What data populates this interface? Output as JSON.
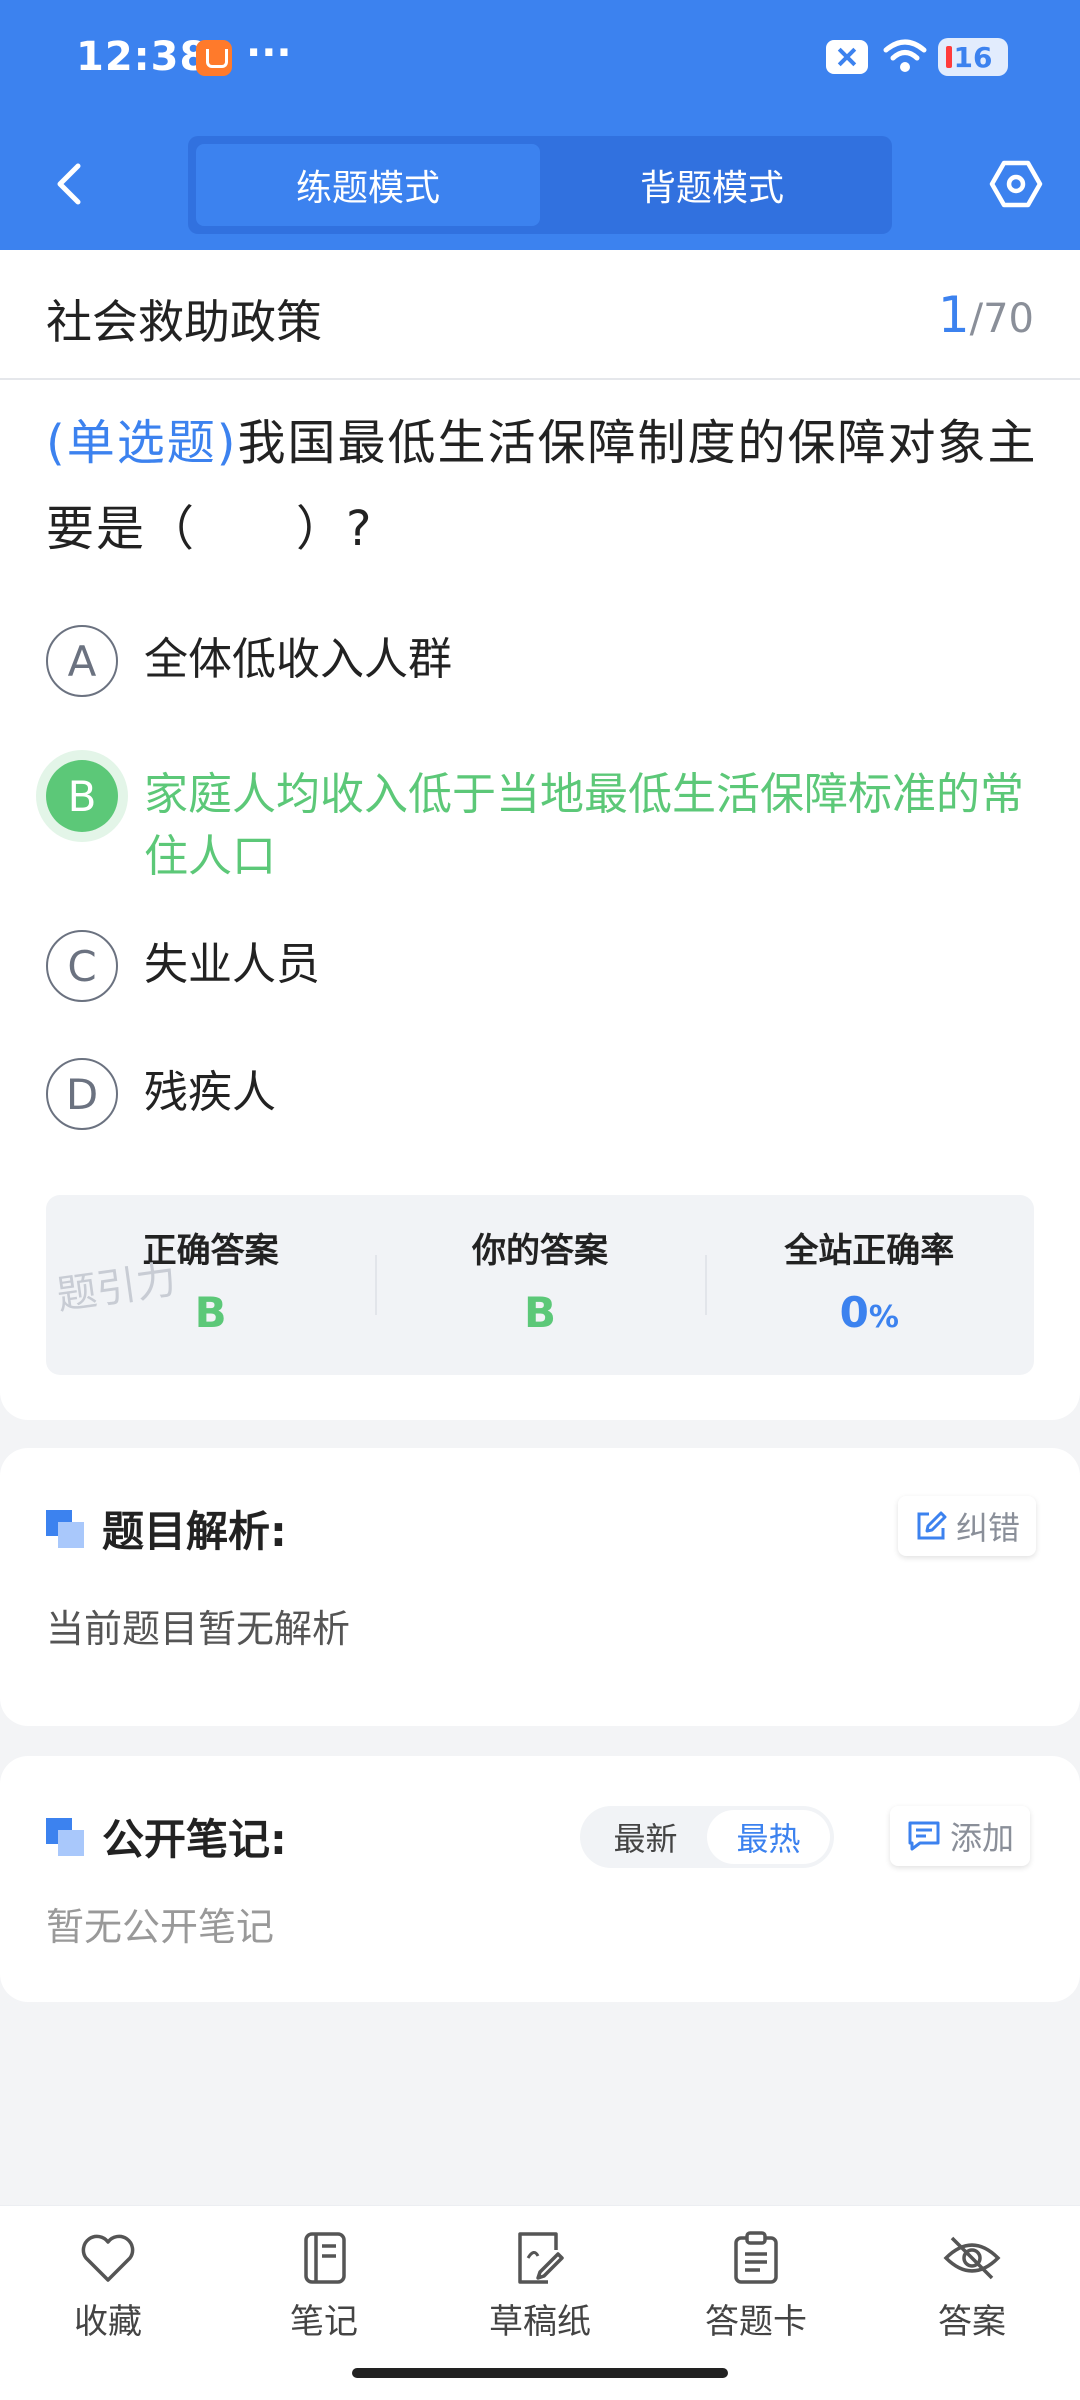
{
  "status_bar": {
    "time": "12:38",
    "dots": "···",
    "battery": "16"
  },
  "nav": {
    "tabs": [
      {
        "label": "练题模式"
      },
      {
        "label": "背题模式"
      }
    ]
  },
  "question": {
    "chapter": "社会救助政策",
    "current": "1",
    "total": "/70",
    "type": "(单选题)",
    "text": "我国最低生活保障制度的保障对象主要是（　　）?",
    "options": [
      {
        "letter": "A",
        "text": "全体低收入人群"
      },
      {
        "letter": "B",
        "text": "家庭人均收入低于当地最低生活保障标准的常住人口"
      },
      {
        "letter": "C",
        "text": "失业人员"
      },
      {
        "letter": "D",
        "text": "残疾人"
      }
    ]
  },
  "stats": {
    "correct_label": "正确答案",
    "correct_value": "B",
    "yours_label": "你的答案",
    "yours_value": "B",
    "rate_label": "全站正确率",
    "rate_value": "0",
    "rate_unit": "%"
  },
  "watermark": "题引力",
  "analysis": {
    "title": "题目解析:",
    "report_button": "纠错",
    "body": "当前题目暂无解析"
  },
  "notes": {
    "title": "公开笔记:",
    "sort_latest": "最新",
    "sort_hot": "最热",
    "add_button": "添加",
    "empty": "暂无公开笔记"
  },
  "bottom_bar": [
    {
      "icon": "heart-icon",
      "label": "收藏"
    },
    {
      "icon": "notebook-icon",
      "label": "笔记"
    },
    {
      "icon": "draft-icon",
      "label": "草稿纸"
    },
    {
      "icon": "clipboard-icon",
      "label": "答题卡"
    },
    {
      "icon": "eye-off-icon",
      "label": "答案"
    }
  ],
  "colors": {
    "primary": "#3c82ef",
    "correct": "#5cc878"
  }
}
